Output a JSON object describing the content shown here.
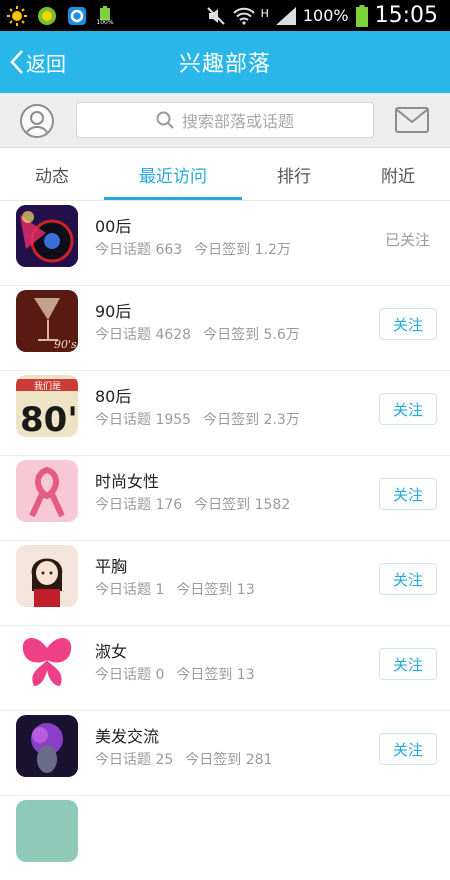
{
  "status_bar": {
    "battery_small": "100%",
    "network": "H",
    "battery": "100%",
    "time": "15:05",
    "icons": [
      "sun-icon",
      "game-icon",
      "browser-icon",
      "battery-small-icon",
      "mute-icon",
      "wifi-icon",
      "signal-icon",
      "battery-icon"
    ]
  },
  "header": {
    "back_label": "返回",
    "title": "兴趣部落",
    "color": "#29b6e8"
  },
  "search": {
    "placeholder": "搜索部落或话题"
  },
  "tabs": [
    {
      "label": "动态",
      "active": false
    },
    {
      "label": "最近访问",
      "active": true
    },
    {
      "label": "排行",
      "active": false
    },
    {
      "label": "附近",
      "active": false
    }
  ],
  "accent_color": "#25a8dd",
  "follow_label": "关注",
  "followed_label": "已关注",
  "tribes": [
    {
      "name": "00后",
      "topics": "今日话题 663",
      "checkins": "今日签到 1.2万",
      "followed": true
    },
    {
      "name": "90后",
      "topics": "今日话题 4628",
      "checkins": "今日签到 5.6万",
      "followed": false
    },
    {
      "name": "80后",
      "topics": "今日话题 1955",
      "checkins": "今日签到 2.3万",
      "followed": false
    },
    {
      "name": "时尚女性",
      "topics": "今日话题 176",
      "checkins": "今日签到 1582",
      "followed": false
    },
    {
      "name": "平胸",
      "topics": "今日话题 1",
      "checkins": "今日签到 13",
      "followed": false
    },
    {
      "name": "淑女",
      "topics": "今日话题 0",
      "checkins": "今日签到 13",
      "followed": false
    },
    {
      "name": "美发交流",
      "topics": "今日话题 25",
      "checkins": "今日签到 281",
      "followed": false
    }
  ],
  "thumb_text": {
    "t90": "90's",
    "t80_banner": "我们是",
    "t80_big": "80'"
  }
}
